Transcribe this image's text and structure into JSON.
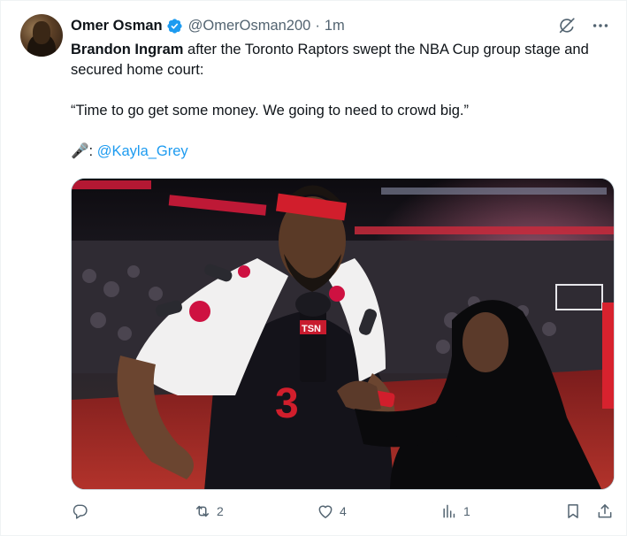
{
  "tweet": {
    "author_name": "Omer Osman",
    "handle": "@OmerOsman200",
    "separator": "·",
    "time": "1m",
    "text": {
      "bold_name": "Brandon Ingram",
      "line1_rest": " after the Toronto Raptors swept the NBA Cup group stage and secured home court:",
      "quote": "“Time to go get some money. We going to need to crowd big.”",
      "mic_emoji": "🎤",
      "mic_suffix": ": ",
      "mention": "@Kayla_Grey"
    },
    "media": {
      "jersey_text": "3",
      "mic_brand": "TSN"
    },
    "actions": {
      "replies": "",
      "reposts": "2",
      "likes": "4",
      "views": "1"
    }
  },
  "colors": {
    "link": "#1d9bf0",
    "muted": "#536471",
    "verified": "#1d9bf0",
    "raptors_red": "#ce1141"
  },
  "icons": [
    "verified-badge-icon",
    "grok-icon",
    "more-icon",
    "reply-icon",
    "repost-icon",
    "like-icon",
    "views-icon",
    "bookmark-icon",
    "share-icon"
  ]
}
